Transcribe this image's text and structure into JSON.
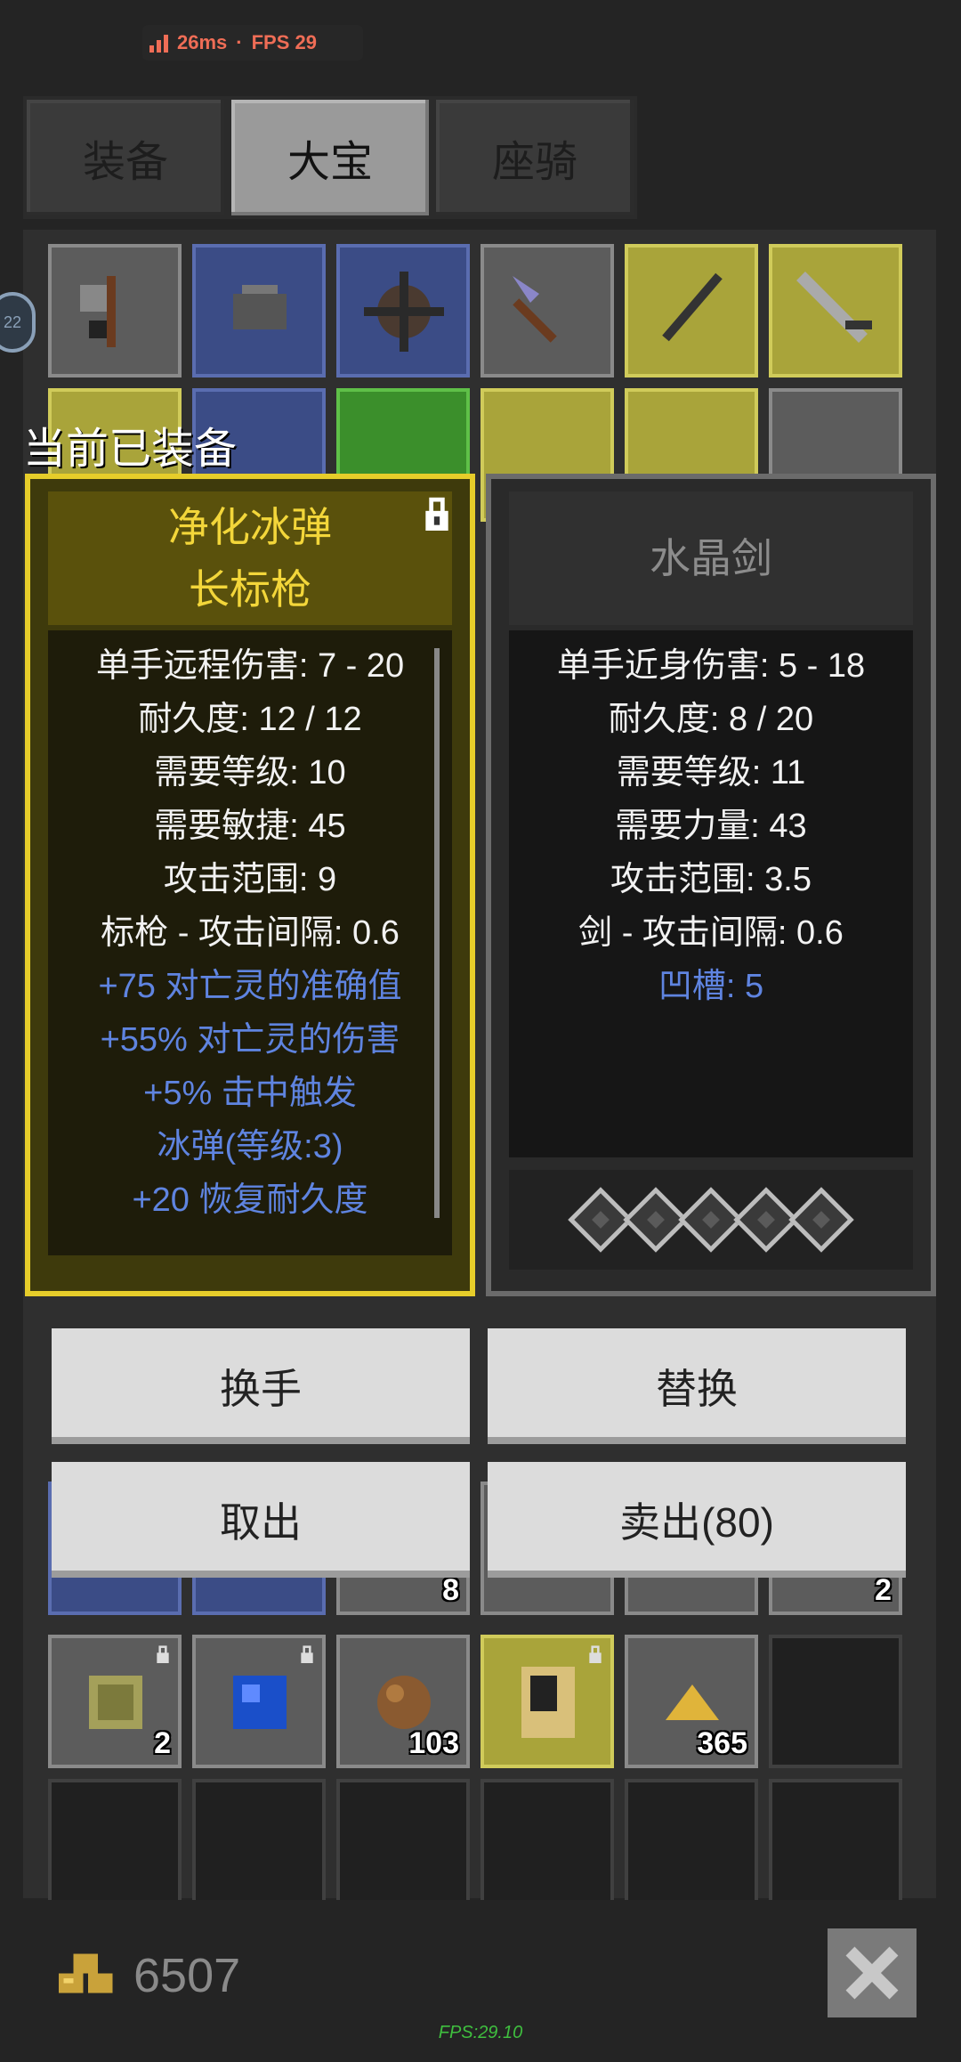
{
  "status": {
    "ping": "26ms",
    "separator": "·",
    "fps": "FPS 29"
  },
  "tabs": [
    {
      "label": "装备",
      "active": false
    },
    {
      "label": "大宝",
      "active": true
    },
    {
      "label": "座骑",
      "active": false
    }
  ],
  "side_badge": "22",
  "current_equipped_label": "当前已装备",
  "inventory": {
    "row_bottom_qty": [
      "2",
      "103",
      "365"
    ],
    "row_top_qty": [
      "8",
      "2"
    ]
  },
  "left_item": {
    "name_line1": "净化冰弹",
    "name_line2": "长标枪",
    "stats": [
      "单手远程伤害: 7 - 20",
      "耐久度: 12 / 12",
      "需要等级: 10",
      "需要敏捷: 45",
      "攻击范围: 9",
      "标枪 - 攻击间隔: 0.6"
    ],
    "bonuses": [
      "+75 对亡灵的准确值",
      "+55% 对亡灵的伤害",
      "+5% 击中触发",
      "冰弹(等级:3)",
      "+20 恢复耐久度"
    ],
    "color_name": "#f3d63a",
    "color_bonus": "#5f84e0"
  },
  "right_item": {
    "name": "水晶剑",
    "stats": [
      "单手近身伤害: 5 - 18",
      "耐久度: 8 / 20",
      "需要等级: 11",
      "需要力量: 43",
      "攻击范围: 3.5",
      "剑 - 攻击间隔: 0.6"
    ],
    "bonuses": [
      "凹槽: 5"
    ],
    "socket_count": 5
  },
  "actions": {
    "swap_hand": "换手",
    "replace": "替换",
    "take_out": "取出",
    "sell": "卖出(80)"
  },
  "gold": "6507",
  "fps_footer": "FPS:29.10"
}
